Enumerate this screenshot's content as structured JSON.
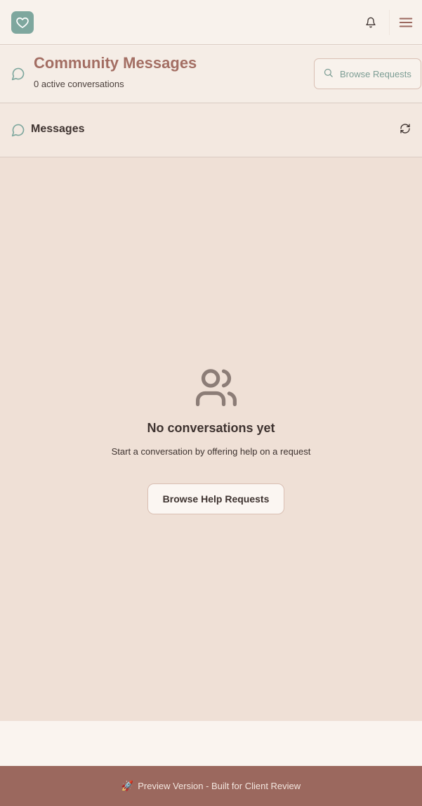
{
  "topbar": {
    "logo": "heart-icon",
    "notifications": "bell-icon",
    "menu": "hamburger-menu-icon"
  },
  "header": {
    "title": "Community Messages",
    "subtitle": "0 active conversations",
    "browse_button_label": "Browse Requests",
    "browse_button_icon": "search-icon",
    "icon": "chat-bubble-icon"
  },
  "messages_panel": {
    "title": "Messages",
    "icon": "chat-bubble-icon",
    "refresh_icon": "refresh-icon"
  },
  "empty_state": {
    "icon": "users-icon",
    "title": "No conversations yet",
    "text": "Start a conversation by offering help on a request",
    "button_label": "Browse Help Requests"
  },
  "footer": {
    "banner_icon": "🚀",
    "banner_text": "Preview Version - Built for Client Review"
  },
  "colors": {
    "accent": "#7ea79e",
    "title": "#a36e63",
    "banner": "#9b685e",
    "content_bg": "#efe0d6"
  }
}
